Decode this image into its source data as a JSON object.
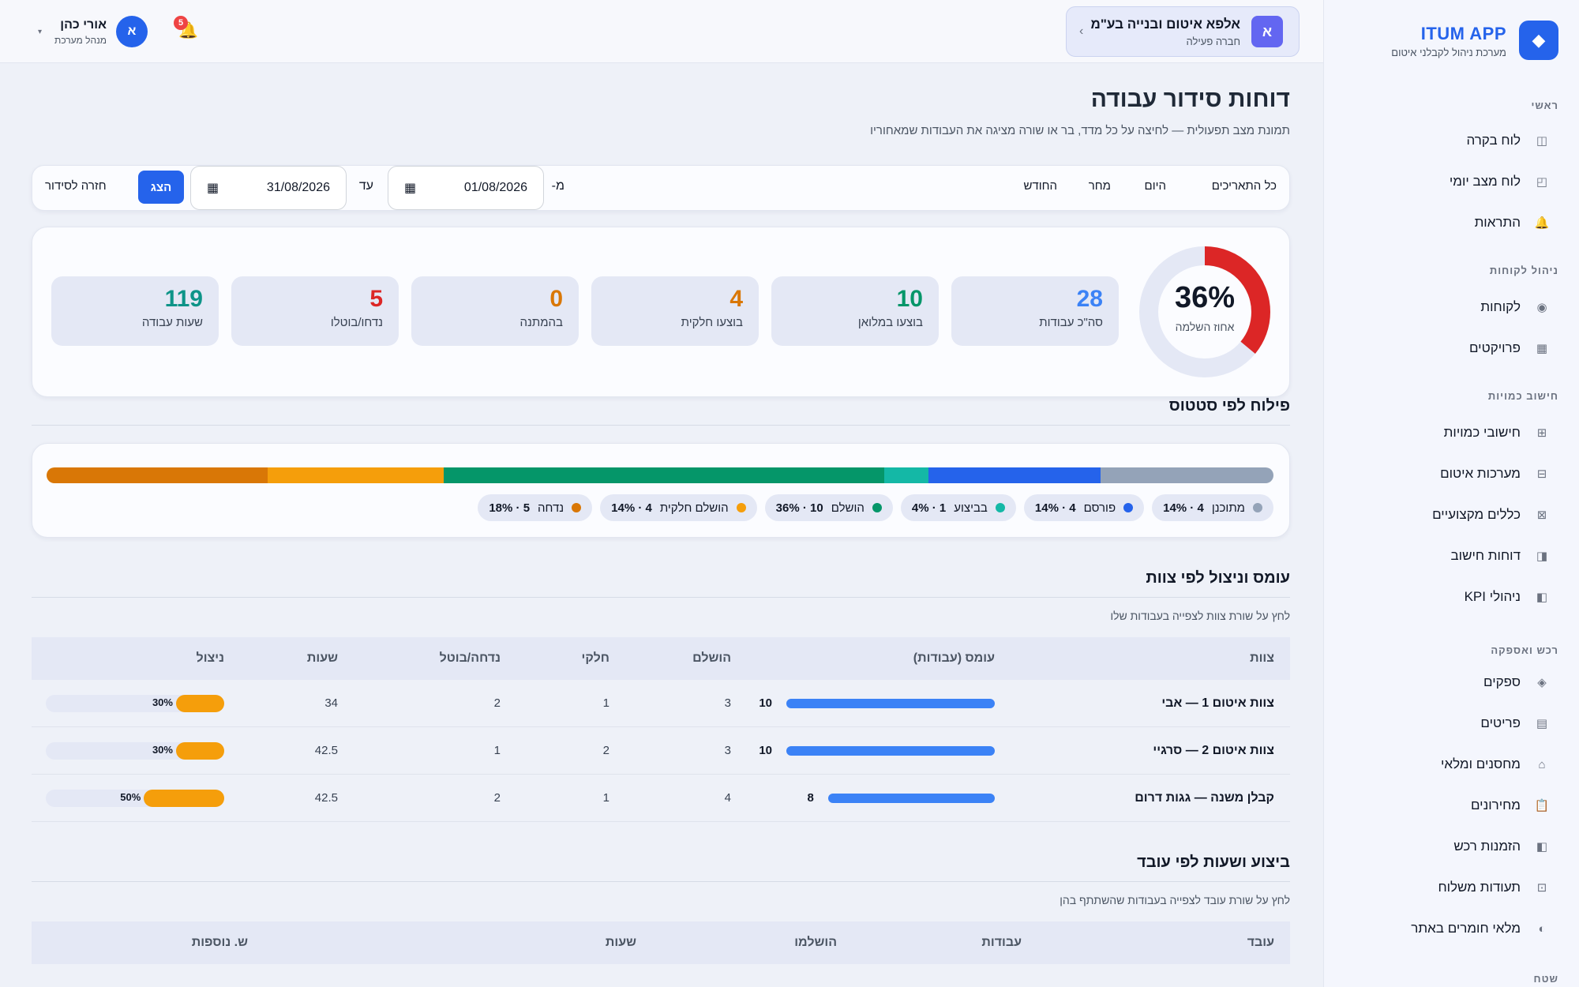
{
  "sidebar": {
    "brand_name": "ITUM APP",
    "brand_sub": "מערכת ניהול לקבלני איטום",
    "brand_icon": "◆",
    "sections": [
      {
        "title": "ראשי",
        "items": [
          {
            "label": "לוח בקרה",
            "icon": "◫"
          },
          {
            "label": "לוח מצב יומי",
            "icon": "◰"
          },
          {
            "label": "התראות",
            "icon": "🔔"
          }
        ]
      },
      {
        "title": "ניהול לקוחות",
        "items": [
          {
            "label": "לקוחות",
            "icon": "◉"
          },
          {
            "label": "פרויקטים",
            "icon": "▦"
          }
        ]
      },
      {
        "title": "חישוב כמויות",
        "items": [
          {
            "label": "חישובי כמויות",
            "icon": "⊞"
          },
          {
            "label": "מערכות איטום",
            "icon": "⊟"
          },
          {
            "label": "כללים מקצועיים",
            "icon": "⊠"
          },
          {
            "label": "דוחות חישוב",
            "icon": "◨"
          },
          {
            "label": "KPI ניהולי",
            "icon": "◧"
          }
        ]
      },
      {
        "title": "רכש ואספקה",
        "items": [
          {
            "label": "ספקים",
            "icon": "◈"
          },
          {
            "label": "פריטים",
            "icon": "▤"
          },
          {
            "label": "מחסנים ומלאי",
            "icon": "⌂"
          },
          {
            "label": "מחירונים",
            "icon": "📋"
          },
          {
            "label": "הזמנות רכש",
            "icon": "◧"
          },
          {
            "label": "תעודות משלוח",
            "icon": "⊡"
          },
          {
            "label": "מלאי חומרים באתר",
            "icon": "◐"
          }
        ]
      },
      {
        "title": "שטח",
        "items": []
      }
    ]
  },
  "topbar": {
    "company_name": "אלפא איטום ובנייה בע\"מ",
    "company_role": "חברה פעילה",
    "company_avatar": "א",
    "company_chevron": "‹",
    "user_name": "אורי כהן",
    "user_role": "מנהל מערכת",
    "user_avatar": "א",
    "user_caret": "▾",
    "bell_icon": "🔔",
    "notifications": "5"
  },
  "page": {
    "title": "דוחות סידור עבודה",
    "subtitle": "תמונת מצב תפעולית — לחיצה על כל מדד, בר או שורה מציגה את העבודות שמאחוריו"
  },
  "filters": {
    "all_dates": "כל התאריכים",
    "today": "היום",
    "tomorrow": "מחר",
    "this_month": "החודש",
    "from_label": "מ-",
    "from_date": "01/08/2026",
    "to_label": "עד",
    "to_date": "31/08/2026",
    "calendar_icon": "▦",
    "show_button": "הצג",
    "back_button": "חזרה לסידור"
  },
  "summary": {
    "completion_value": "36%",
    "completion_fraction": 0.36,
    "completion_label": "אחוז השלמה",
    "colors": {
      "track": "#e4e8f5",
      "arc": "#dc2626"
    },
    "cards": [
      {
        "value": "28",
        "label": "סה\"כ עבודות",
        "color": "#3b82f6"
      },
      {
        "value": "10",
        "label": "בוצעו במלואן",
        "color": "#059669"
      },
      {
        "value": "4",
        "label": "בוצעו חלקית",
        "color": "#d97706"
      },
      {
        "value": "0",
        "label": "בהמתנה",
        "color": "#d97706"
      },
      {
        "value": "5",
        "label": "נדחו/בוטלו",
        "color": "#dc2626"
      },
      {
        "value": "119",
        "label": "שעות עבודה",
        "color": "#0d9488"
      }
    ]
  },
  "status_breakdown": {
    "title": "פילוח לפי סטטוס",
    "items": [
      {
        "name": "מתוכנן",
        "count": "4",
        "percent": "14%",
        "fraction": 0.14,
        "color": "#94a3b8"
      },
      {
        "name": "פורסם",
        "count": "4",
        "percent": "14%",
        "fraction": 0.14,
        "color": "#2563eb"
      },
      {
        "name": "בביצוע",
        "count": "1",
        "percent": "4%",
        "fraction": 0.036,
        "color": "#14b8a6"
      },
      {
        "name": "הושלם",
        "count": "10",
        "percent": "36%",
        "fraction": 0.357,
        "color": "#059669"
      },
      {
        "name": "הושלם חלקית",
        "count": "4",
        "percent": "14%",
        "fraction": 0.143,
        "color": "#f59e0b"
      },
      {
        "name": "נדחה",
        "count": "5",
        "percent": "18%",
        "fraction": 0.179,
        "color": "#d97706"
      }
    ]
  },
  "teams": {
    "title": "עומס וניצול לפי צוות",
    "subtitle": "לחץ על שורת צוות לצפייה בעבודות שלו",
    "headers": [
      "צוות",
      "עומס (עבודות)",
      "הושלם",
      "חלקי",
      "נדחה/בוטל",
      "שעות",
      "ניצול"
    ],
    "rows": [
      {
        "team": "צוות איטום 1 — אבי",
        "load": "10",
        "load_fraction": 1.0,
        "done": "3",
        "partial": "1",
        "rejected": "2",
        "hours": "34",
        "util": "30%",
        "util_fraction": 0.3
      },
      {
        "team": "צוות איטום 2 — סרגיי",
        "load": "10",
        "load_fraction": 1.0,
        "done": "3",
        "partial": "2",
        "rejected": "1",
        "hours": "42.5",
        "util": "30%",
        "util_fraction": 0.3
      },
      {
        "team": "קבלן משנה — גגות דרום",
        "load": "8",
        "load_fraction": 0.8,
        "done": "4",
        "partial": "1",
        "rejected": "2",
        "hours": "42.5",
        "util": "50%",
        "util_fraction": 0.5
      }
    ]
  },
  "workers": {
    "title": "ביצוע ושעות לפי עובד",
    "subtitle": "לחץ על שורת עובד לצפייה בעבודות שהשתתף בהן",
    "headers": [
      "עובד",
      "עבודות",
      "הושלמו",
      "שעות",
      "ש. נוספות"
    ]
  }
}
